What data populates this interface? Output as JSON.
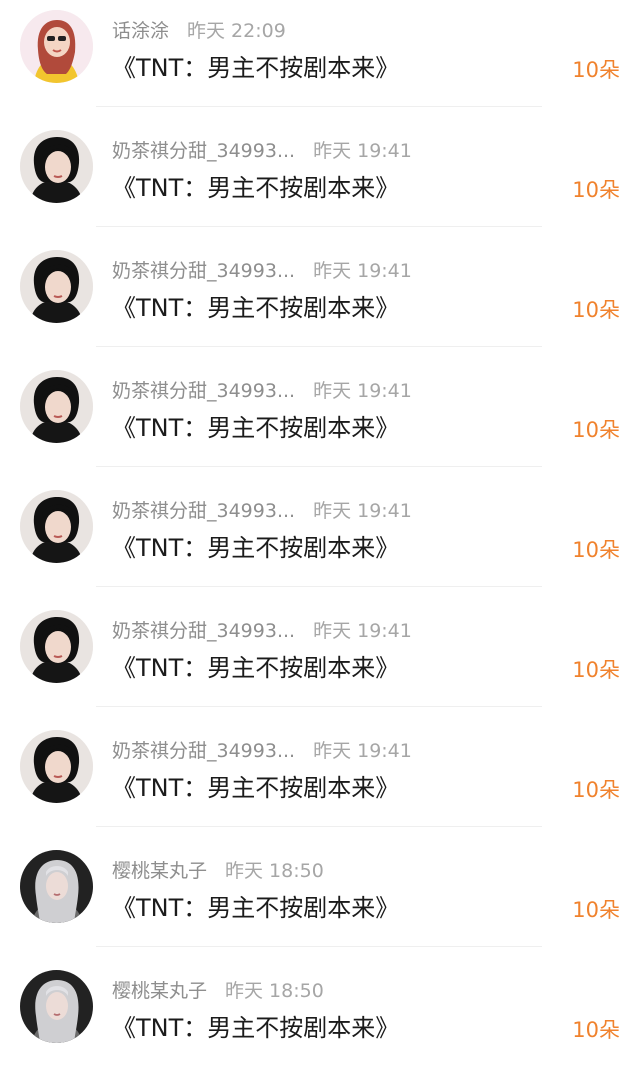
{
  "gift_list": {
    "items": [
      {
        "avatar_icon": "user-avatar-icon",
        "username": "话涂涂",
        "time": "昨天 22:09",
        "message": "《TNT：男主不按剧本来》",
        "count": "10朵"
      },
      {
        "avatar_icon": "user-avatar-icon",
        "username": "奶茶祺分甜_34993...",
        "time": "昨天 19:41",
        "message": "《TNT：男主不按剧本来》",
        "count": "10朵"
      },
      {
        "avatar_icon": "user-avatar-icon",
        "username": "奶茶祺分甜_34993...",
        "time": "昨天 19:41",
        "message": "《TNT：男主不按剧本来》",
        "count": "10朵"
      },
      {
        "avatar_icon": "user-avatar-icon",
        "username": "奶茶祺分甜_34993...",
        "time": "昨天 19:41",
        "message": "《TNT：男主不按剧本来》",
        "count": "10朵"
      },
      {
        "avatar_icon": "user-avatar-icon",
        "username": "奶茶祺分甜_34993...",
        "time": "昨天 19:41",
        "message": "《TNT：男主不按剧本来》",
        "count": "10朵"
      },
      {
        "avatar_icon": "user-avatar-icon",
        "username": "奶茶祺分甜_34993...",
        "time": "昨天 19:41",
        "message": "《TNT：男主不按剧本来》",
        "count": "10朵"
      },
      {
        "avatar_icon": "user-avatar-icon",
        "username": "奶茶祺分甜_34993...",
        "time": "昨天 19:41",
        "message": "《TNT：男主不按剧本来》",
        "count": "10朵"
      },
      {
        "avatar_icon": "user-avatar-icon",
        "username": "樱桃某丸子",
        "time": "昨天 18:50",
        "message": "《TNT：男主不按剧本来》",
        "count": "10朵"
      },
      {
        "avatar_icon": "user-avatar-icon",
        "username": "樱桃某丸子",
        "time": "昨天 18:50",
        "message": "《TNT：男主不按剧本来》",
        "count": "10朵"
      }
    ]
  },
  "colors": {
    "accent": "#f0822d",
    "username": "#8e8e8e",
    "time": "#a6a6a6",
    "message": "#1b1b1b",
    "divider": "#efefef"
  }
}
